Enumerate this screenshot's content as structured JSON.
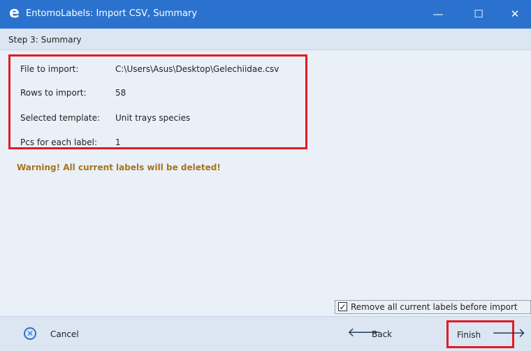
{
  "window": {
    "logo_glyph": "e",
    "title": "EntomoLabels: Import CSV, Summary",
    "minimize_glyph": "—",
    "maximize_glyph": "☐",
    "close_glyph": "✕"
  },
  "step": {
    "label": "Step 3: Summary"
  },
  "summary": {
    "rows": [
      {
        "label": "File to import:",
        "value": "C:\\Users\\Asus\\Desktop\\Gelechiidae.csv"
      },
      {
        "label": "Rows to import:",
        "value": "58"
      },
      {
        "label": "Selected template:",
        "value": "Unit trays species"
      },
      {
        "label": "Pcs for each label:",
        "value": "1"
      }
    ]
  },
  "warning": {
    "text": "Warning! All current labels will be deleted!"
  },
  "options": {
    "remove_labels": {
      "label": "Remove all current labels before import",
      "checked": true,
      "check_glyph": "✓"
    }
  },
  "footer": {
    "cancel_icon": "⊗",
    "cancel_label": "Cancel",
    "back_icon": "🡐",
    "back_label": "Back",
    "finish_label": "Finish",
    "finish_icon": "🡒"
  },
  "colors": {
    "titlebar": "#2b72cf",
    "highlight_border": "#e21b24",
    "warning_text": "#a8731d"
  }
}
